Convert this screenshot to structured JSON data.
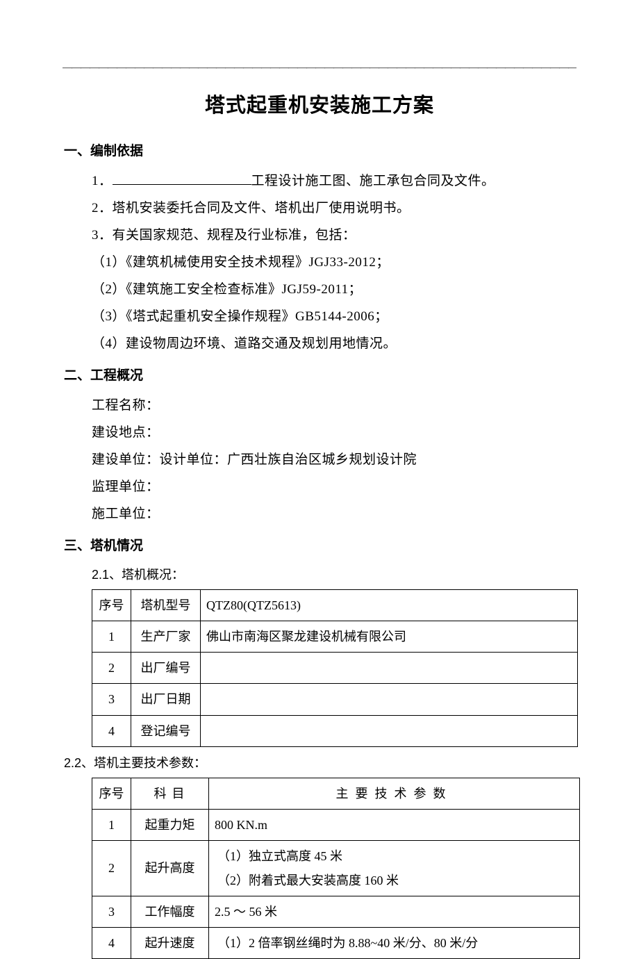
{
  "hr": "————————————————————————————————————————————————————————————————————",
  "title": "塔式起重机安装施工方案",
  "s1": {
    "head": "一、编制依据",
    "l1a": "1．",
    "l1b": "工程设计施工图、施工承包合同及文件。",
    "l2": "2．塔机安装委托合同及文件、塔机出厂使用说明书。",
    "l3": "3．有关国家规范、规程及行业标准，包括：",
    "l4": "（1）《建筑机械使用安全技术规程》JGJ33-2012；",
    "l5": "（2）《建筑施工安全检查标准》JGJ59-2011；",
    "l6": "（3）《塔式起重机安全操作规程》GB5144-2006；",
    "l7": "（4）建设物周边环境、道路交通及规划用地情况。"
  },
  "s2": {
    "head": "二、工程概况",
    "l1": "工程名称：",
    "l2": "建设地点：",
    "l3": "建设单位：设计单位：广西壮族自治区城乡规划设计院",
    "l4": "监理单位：",
    "l5": "施工单位："
  },
  "s3": {
    "head": "三、塔机情况",
    "sub1": "2.1、塔机概况：",
    "t1": {
      "h1": "序号",
      "h2": "塔机型号",
      "h3": "QTZ80(QTZ5613)",
      "r1a": "1",
      "r1b": "生产厂家",
      "r1c": "佛山市南海区聚龙建设机械有限公司",
      "r2a": "2",
      "r2b": "出厂编号",
      "r2c": "",
      "r3a": "3",
      "r3b": "出厂日期",
      "r3c": "",
      "r4a": "4",
      "r4b": "登记编号",
      "r4c": ""
    },
    "sub2": "2.2、塔机主要技术参数：",
    "t2": {
      "h1": "序号",
      "h2": "科目",
      "h3": "主要技术参数",
      "r1a": "1",
      "r1b": "起重力矩",
      "r1c": "800  KN.m",
      "r2a": "2",
      "r2b": "起升高度",
      "r2c1": "（1）独立式高度 45 米",
      "r2c2": "（2）附着式最大安装高度 160 米",
      "r3a": "3",
      "r3b": "工作幅度",
      "r3c": "2.5 ～ 56 米",
      "r4a": "4",
      "r4b": "起升速度",
      "r4c": "（1）2 倍率钢丝绳时为 8.88~40 米/分、80 米/分"
    }
  }
}
